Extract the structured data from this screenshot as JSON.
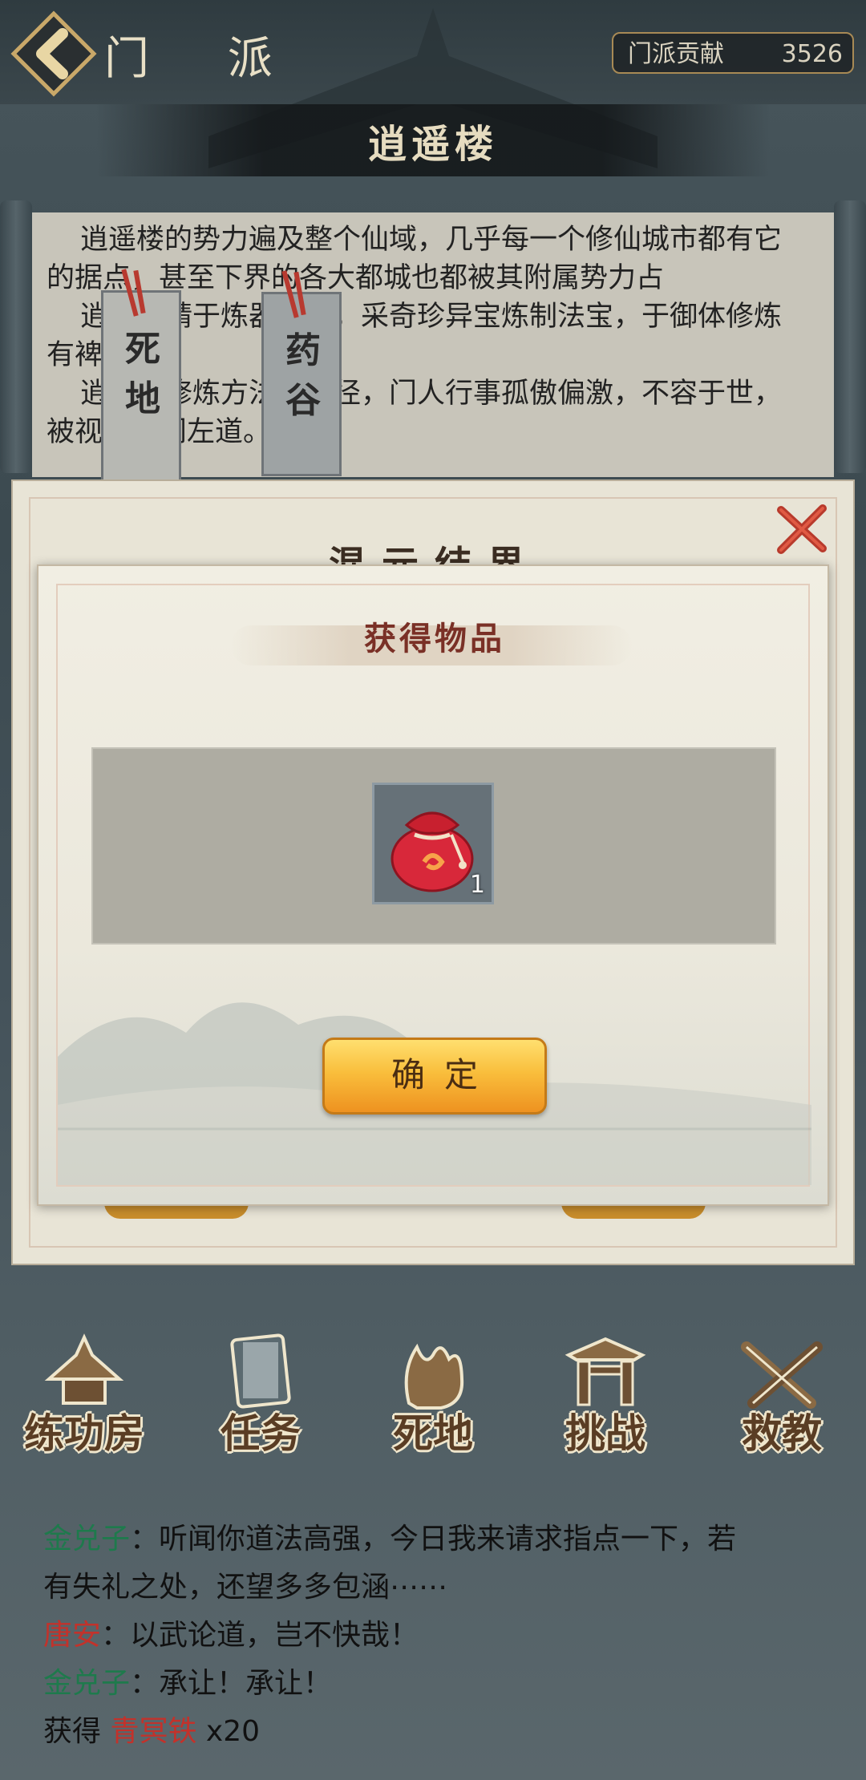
{
  "header": {
    "title": "门 派",
    "contribution_label": "门派贡献",
    "contribution_value": "3526",
    "section_title": "逍遥楼"
  },
  "description": {
    "paragraphs": [
      "逍遥楼的势力遍及整个仙域，几乎每一个修仙城市都有它的据点，甚至下界的各大都城也都被其附属势力占",
      "逍遥楼精于炼器之道，采奇珍异宝炼制法宝，于御体修炼有裨益",
      "逍遥楼修炼方法僻蹊径，门人行事孤傲偏激，不容于世，被视为旁门左道。"
    ]
  },
  "tablets": {
    "left": "死地",
    "right": "药谷"
  },
  "outer_dialog": {
    "title": "混元结界"
  },
  "reward_dialog": {
    "title": "获得物品",
    "item_name": "red-lucky-bag",
    "item_count": "1",
    "confirm_label": "确定"
  },
  "nav": {
    "items": [
      {
        "label": "练功房",
        "icon": "pagoda-icon"
      },
      {
        "label": "任务",
        "icon": "scroll-icon"
      },
      {
        "label": "死地",
        "icon": "flame-skull-icon"
      },
      {
        "label": "挑战",
        "icon": "gate-icon"
      },
      {
        "label": "救教",
        "icon": "crossed-swords-icon"
      }
    ]
  },
  "chat": {
    "lines": [
      {
        "speaker": "金兑子",
        "text": "：听闻你道法高强，今日我来请求指点一下，若"
      },
      {
        "speaker": "",
        "text": "有失礼之处，还望多多包涵⋯⋯"
      },
      {
        "speaker": "唐安",
        "text": "：以武论道，岂不快哉！"
      },
      {
        "speaker": "金兑子",
        "text": "：承让！承让！"
      },
      {
        "prefix": "获得 ",
        "item": "青冥铁",
        "suffix": " x20"
      }
    ]
  },
  "colors": {
    "accent_gold": "#f9be3c",
    "title_red": "#7a3026",
    "speaker_green": "#1e7a4c",
    "speaker_red": "#c2322b"
  }
}
